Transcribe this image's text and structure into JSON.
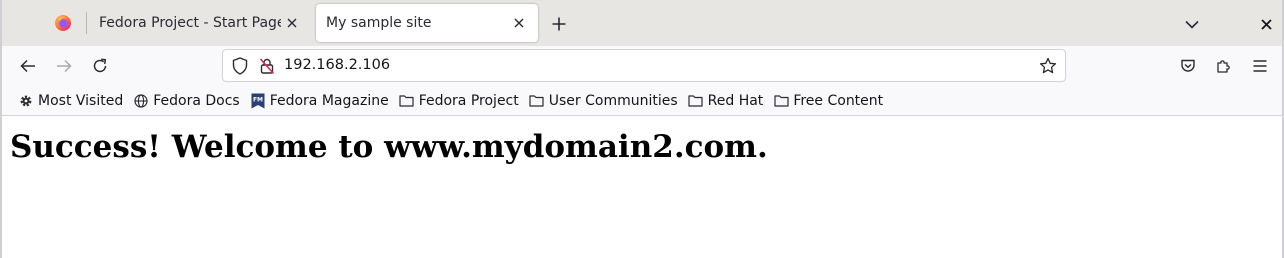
{
  "tabs": [
    {
      "title": "Fedora Project - Start Page",
      "active": false
    },
    {
      "title": "My sample site",
      "active": true
    }
  ],
  "toolbar": {
    "url": "192.168.2.106"
  },
  "bookmarks": [
    {
      "label": "Most Visited",
      "icon": "gear-icon"
    },
    {
      "label": "Fedora Docs",
      "icon": "globe-icon"
    },
    {
      "label": "Fedora Magazine",
      "icon": "fedora-magazine-icon"
    },
    {
      "label": "Fedora Project",
      "icon": "folder-icon"
    },
    {
      "label": "User Communities",
      "icon": "folder-icon"
    },
    {
      "label": "Red Hat",
      "icon": "folder-icon"
    },
    {
      "label": "Free Content",
      "icon": "folder-icon"
    }
  ],
  "page": {
    "heading": "Success! Welcome to www.mydomain2.com."
  },
  "colors": {
    "tabstrip": "#e8e6e3",
    "toolbar": "#f9f9fb",
    "firefox_orange": "#ff7139",
    "firefox_purple": "#9059ff",
    "unsecure_red": "#e22850"
  }
}
